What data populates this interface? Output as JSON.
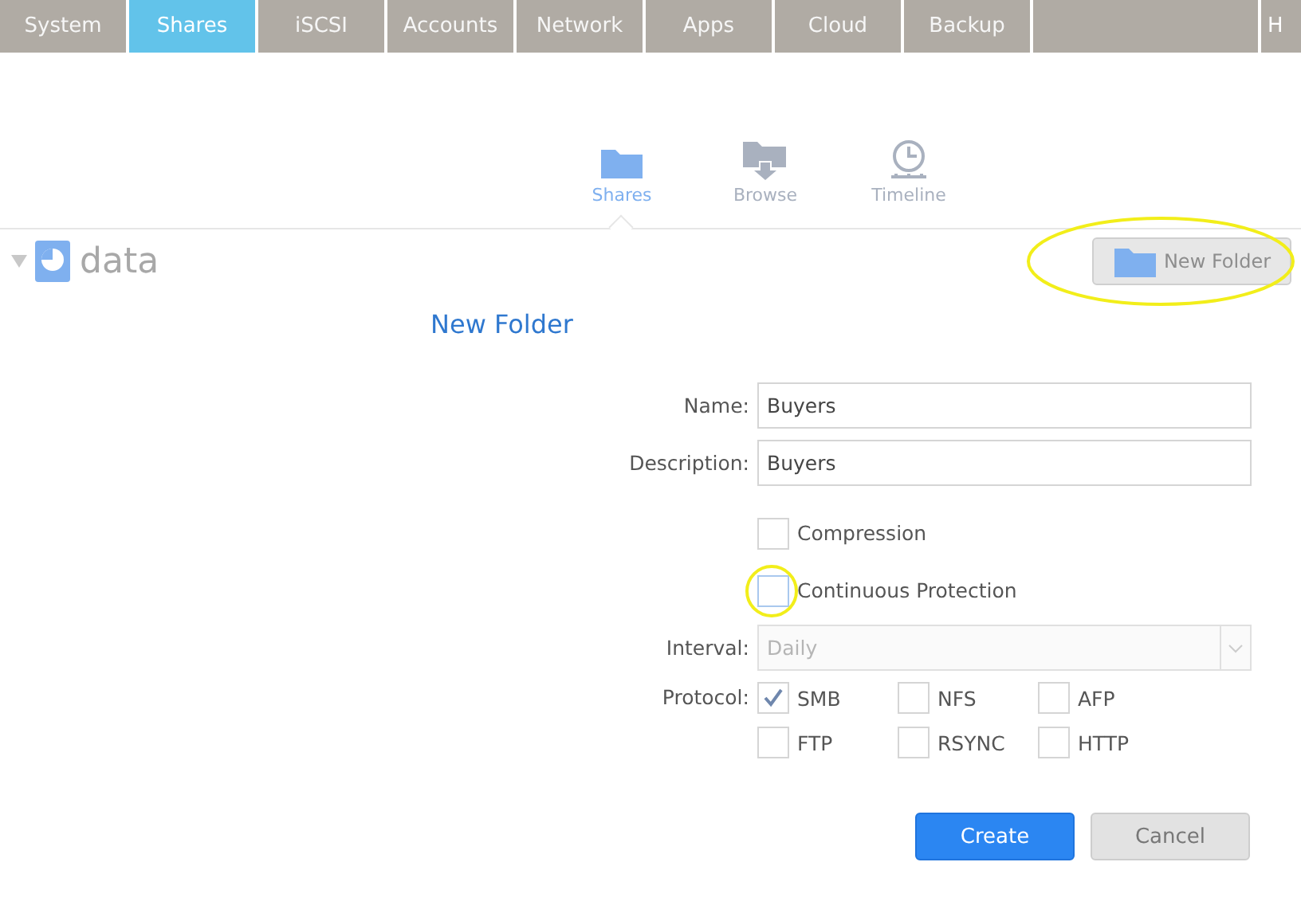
{
  "nav_tabs": [
    {
      "kind": "tab",
      "label": "System",
      "selected": false
    },
    {
      "kind": "tab",
      "label": "Shares",
      "selected": true
    },
    {
      "kind": "tab",
      "label": "iSCSI",
      "selected": false
    },
    {
      "kind": "tab",
      "label": "Accounts",
      "selected": false
    },
    {
      "kind": "tab",
      "label": "Network",
      "selected": false
    },
    {
      "kind": "tab",
      "label": "Apps",
      "selected": false
    },
    {
      "kind": "tab",
      "label": "Cloud",
      "selected": false
    },
    {
      "kind": "tab",
      "label": "Backup",
      "selected": false
    },
    {
      "kind": "blank",
      "selected": false
    },
    {
      "kind": "cut",
      "label": "H",
      "selected": false
    }
  ],
  "sub_tabs": [
    {
      "label": "Shares",
      "selected": true
    },
    {
      "label": "Browse",
      "selected": false
    },
    {
      "label": "Timeline",
      "selected": false
    }
  ],
  "volume": {
    "name": "data",
    "expanded": true
  },
  "new_folder_button": {
    "label": "New Folder",
    "highlighted": true
  },
  "form": {
    "title": "New Folder",
    "fields": [
      {
        "label": "Name:",
        "value": "Buyers"
      },
      {
        "label": "Description:",
        "value": "Buyers"
      }
    ],
    "options": [
      {
        "label": "Compression",
        "checked": false,
        "highlighted": false
      },
      {
        "label": "Continuous Protection",
        "checked": false,
        "highlighted": true
      }
    ],
    "interval": {
      "label": "Interval:",
      "value": "Daily",
      "disabled": true
    },
    "protocol": {
      "label": "Protocol:",
      "options": [
        {
          "label": "SMB",
          "checked": true
        },
        {
          "label": "NFS",
          "checked": false
        },
        {
          "label": "AFP",
          "checked": false
        },
        {
          "label": "FTP",
          "checked": false
        },
        {
          "label": "RSYNC",
          "checked": false
        },
        {
          "label": "HTTP",
          "checked": false
        }
      ]
    },
    "buttons": [
      {
        "label": "Create",
        "kind": "primary"
      },
      {
        "label": "Cancel",
        "kind": "secondary"
      }
    ]
  }
}
